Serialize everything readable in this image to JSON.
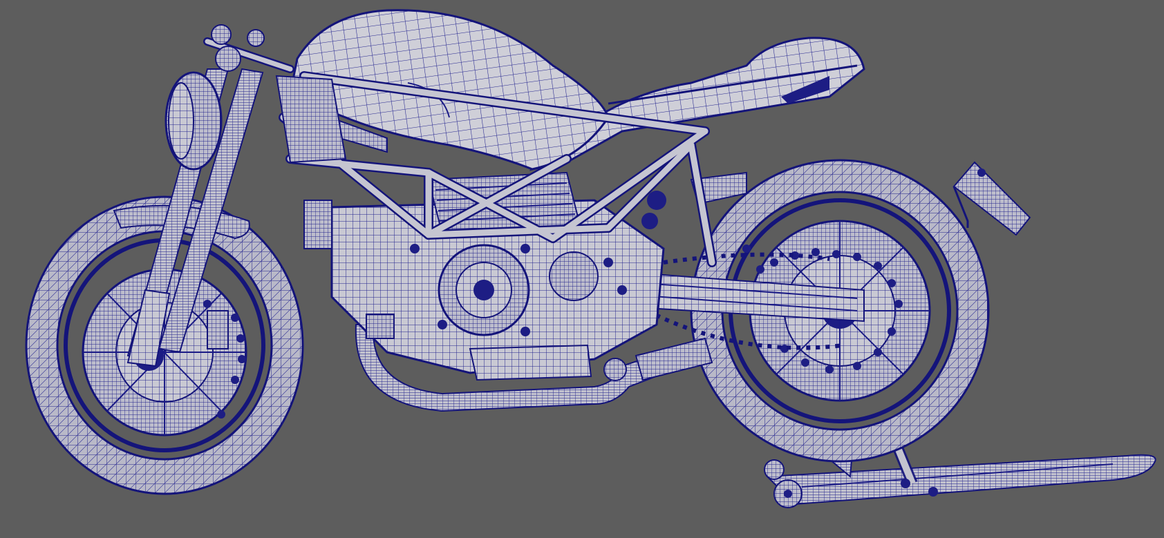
{
  "viewport": {
    "mode": "wireframe-on-shaded",
    "background_color": "#5d5d5d",
    "wire_color": "#1b1b86",
    "shaded_color": "#c9c9d3"
  },
  "scene": {
    "objects": [
      "front-wheel",
      "rear-wheel",
      "fuel-tank",
      "seat-tail",
      "trellis-frame",
      "engine",
      "front-fork",
      "headlight",
      "exhaust-pipe",
      "swingarm",
      "rear-stand",
      "license-plate-bracket"
    ]
  }
}
